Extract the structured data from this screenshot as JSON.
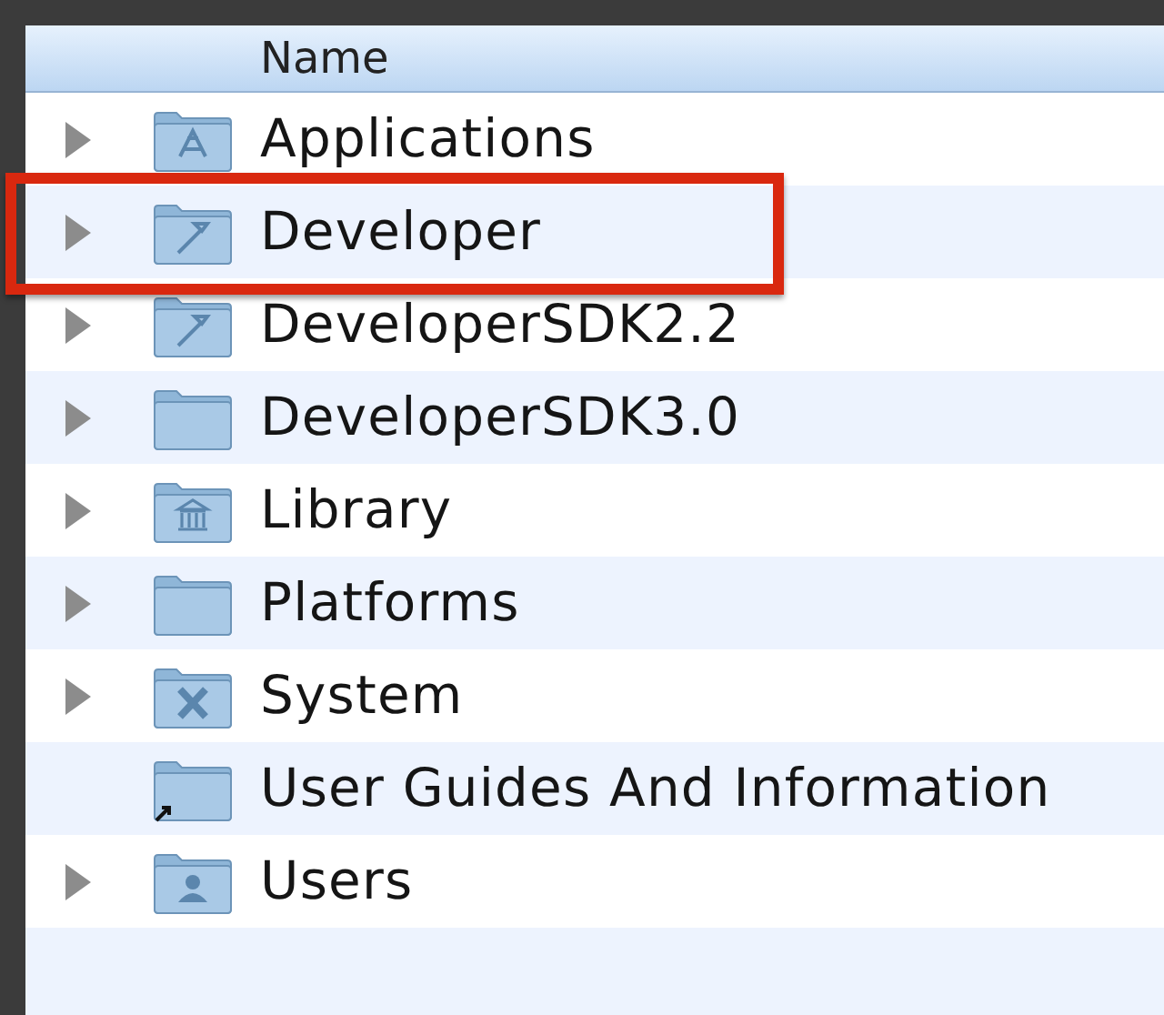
{
  "table": {
    "columns": [
      {
        "label": "Name"
      }
    ],
    "rows": [
      {
        "name": "Applications",
        "kind": "applications",
        "expandable": true,
        "highlighted": false
      },
      {
        "name": "Developer",
        "kind": "developer",
        "expandable": true,
        "highlighted": true
      },
      {
        "name": "DeveloperSDK2.2",
        "kind": "developer",
        "expandable": true,
        "highlighted": false
      },
      {
        "name": "DeveloperSDK3.0",
        "kind": "plain",
        "expandable": true,
        "highlighted": false
      },
      {
        "name": "Library",
        "kind": "library",
        "expandable": true,
        "highlighted": false
      },
      {
        "name": "Platforms",
        "kind": "plain",
        "expandable": true,
        "highlighted": false
      },
      {
        "name": "System",
        "kind": "system",
        "expandable": true,
        "highlighted": false
      },
      {
        "name": "User Guides And Information",
        "kind": "alias",
        "expandable": false,
        "highlighted": false
      },
      {
        "name": "Users",
        "kind": "users",
        "expandable": true,
        "highlighted": false
      }
    ]
  }
}
